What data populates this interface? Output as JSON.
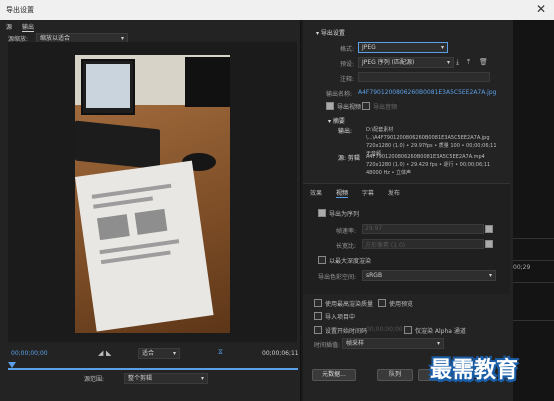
{
  "window": {
    "title": "导出设置",
    "close_glyph": "✕"
  },
  "left": {
    "tabs": [
      "源",
      "输出"
    ],
    "source_scale_label": "源缩放:",
    "source_scale_value": "缩放以适合",
    "timecode_start": "00;00;00;00",
    "timecode_end": "00;00;06;11",
    "fit_value": "适合",
    "source_range_label": "源范围:",
    "source_range_value": "整个剪辑"
  },
  "export": {
    "section_title": "导出设置",
    "format_label": "格式:",
    "format_value": "JPEG",
    "preset_label": "预设:",
    "preset_value": "JPEG 序列 (匹配源)",
    "comment_label": "注释:",
    "output_name_label": "输出名称:",
    "output_name_value": "A4F7901200806260B0081E3A5C5EE2A7A.jpg",
    "export_video_label": "导出视频",
    "export_audio_label": "导出音频",
    "summary_title": "摘要",
    "output_label": "输出:",
    "output_lines": [
      "D:\\配套素材\\...\\A4F7901200806260B0081E3A5C5EE2A7A.jpg",
      "720x1280 (1.0) • 29.97fps • 质量 100 • 00;00;06;11",
      "无音频"
    ],
    "source_label": "源: 剪辑",
    "source_lines": [
      "A4F7901200806260B0081E3A5C5EE2A7A.mp4",
      "720x1280 (1.0) • 29.429 fps • 逐行 • 00;00;06;11",
      "48000 Hz • 立体声"
    ]
  },
  "subtabs": [
    "效果",
    "视频",
    "字幕",
    "发布"
  ],
  "video": {
    "export_sequence_label": "导出为序列",
    "frame_rate_label": "帧速率:",
    "frame_rate_value": "29.97",
    "aspect_label": "长宽比:",
    "aspect_value": "方形像素 (1.0)",
    "max_depth_label": "以最大深度渲染",
    "color_space_label": "导出色彩空间:",
    "color_space_value": "sRGB"
  },
  "options": {
    "max_quality": "使用最高渲染质量",
    "use_preview": "使用预览",
    "import_project": "导入项目中",
    "set_start_tc": "设置开始时间码",
    "start_tc_value": "00;00;00;00",
    "alpha_only": "仅渲染 Alpha 通道",
    "time_interp_label": "时间插值:",
    "time_interp_value": "帧采样"
  },
  "buttons": {
    "metadata": "元数据...",
    "queue": "队列",
    "export": "导出"
  },
  "side": {
    "timecode": "00;29"
  },
  "watermark": "最需教育",
  "colors": {
    "accent": "#5aa0e8"
  }
}
